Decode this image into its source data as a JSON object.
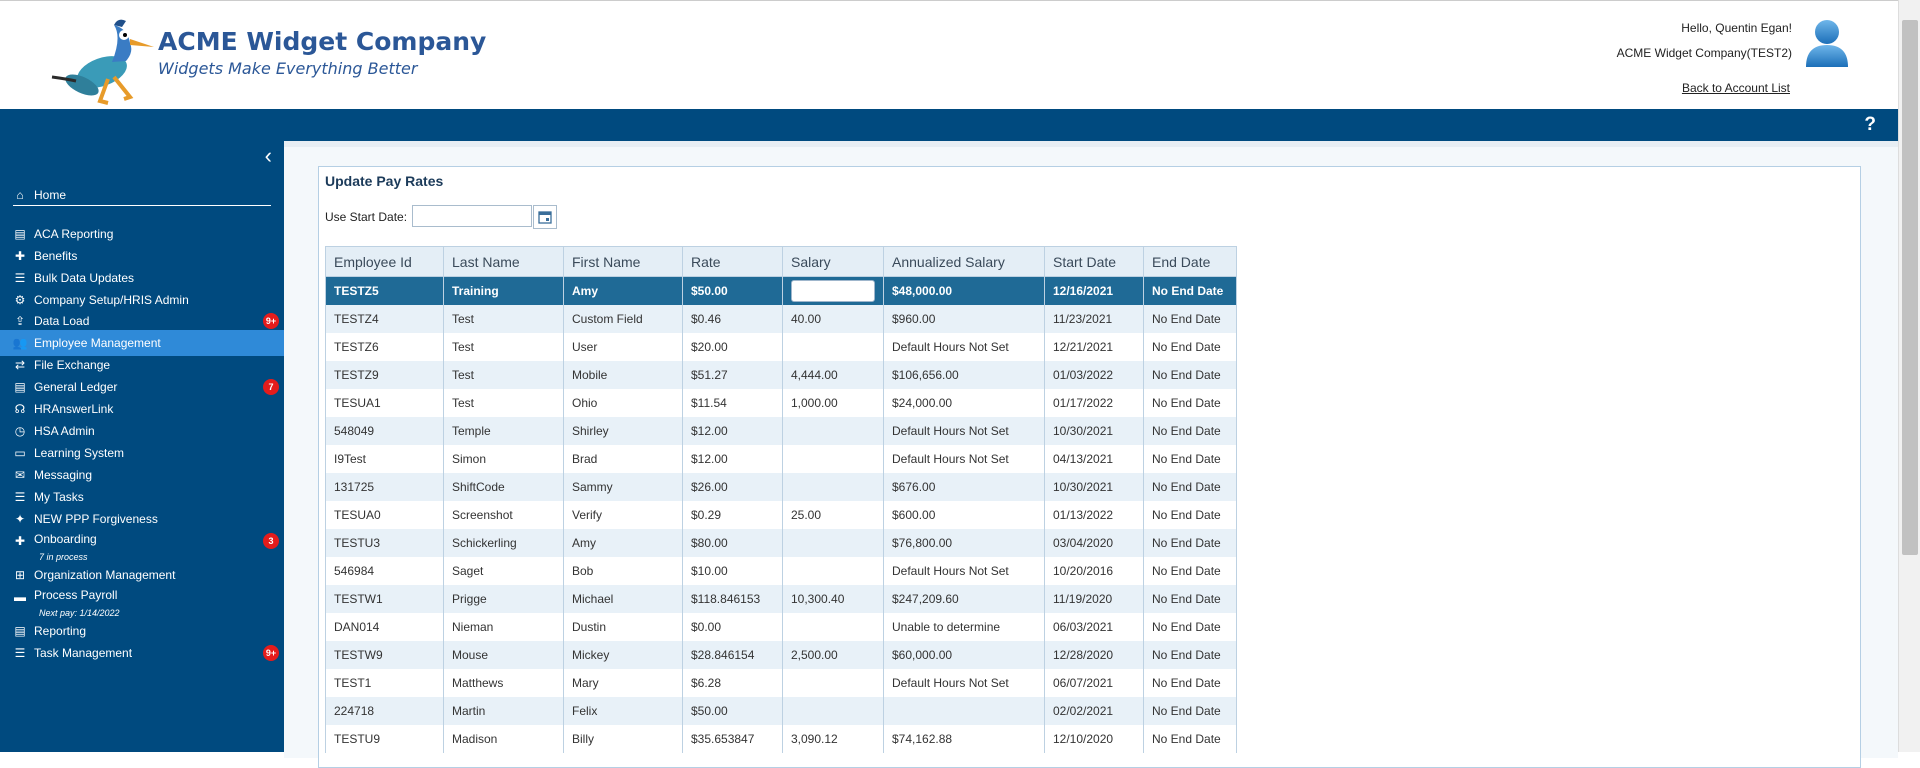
{
  "header": {
    "company_name": "ACME Widget Company",
    "tagline": "Widgets Make Everything Better",
    "greeting": "Hello, Quentin Egan!",
    "account_name": "ACME Widget Company(TEST2)",
    "back_link": "Back to Account List",
    "help_label": "?"
  },
  "colors": {
    "brand_blue": "#004a7f",
    "active_nav": "#2f8ad8",
    "selected_row": "#1f6a96",
    "badge_red": "#e41c1c"
  },
  "sidebar": {
    "collapse_icon": "chevron-left-icon",
    "items": [
      {
        "label": "Home",
        "icon": "home-icon"
      },
      {
        "label": "ACA Reporting",
        "icon": "document-icon"
      },
      {
        "label": "Benefits",
        "icon": "benefits-icon"
      },
      {
        "label": "Bulk Data Updates",
        "icon": "list-icon"
      },
      {
        "label": "Company Setup/HRIS Admin",
        "icon": "users-gear-icon"
      },
      {
        "label": "Data Load",
        "icon": "upload-icon",
        "badge": "9+"
      },
      {
        "label": "Employee Management",
        "icon": "users-icon",
        "active": true
      },
      {
        "label": "File Exchange",
        "icon": "exchange-icon"
      },
      {
        "label": "General Ledger",
        "icon": "ledger-icon",
        "badge": "7"
      },
      {
        "label": "HRAnswerLink",
        "icon": "headset-icon"
      },
      {
        "label": "HSA Admin",
        "icon": "clock-icon"
      },
      {
        "label": "Learning System",
        "icon": "laptop-icon"
      },
      {
        "label": "Messaging",
        "icon": "comments-icon"
      },
      {
        "label": "My Tasks",
        "icon": "tasks-icon"
      },
      {
        "label": "NEW PPP Forgiveness",
        "icon": "gift-icon"
      },
      {
        "label": "Onboarding",
        "icon": "user-plus-icon",
        "badge": "3",
        "sub": "7 in process"
      },
      {
        "label": "Organization Management",
        "icon": "org-chart-icon"
      },
      {
        "label": "Process Payroll",
        "icon": "money-icon",
        "sub": "Next pay: 1/14/2022"
      },
      {
        "label": "Reporting",
        "icon": "report-icon"
      },
      {
        "label": "Task Management",
        "icon": "tasks-icon",
        "badge": "9+"
      }
    ]
  },
  "main": {
    "title": "Update Pay Rates",
    "start_date_label": "Use Start Date:",
    "start_date_value": "",
    "columns": [
      "Employee Id",
      "Last Name",
      "First Name",
      "Rate",
      "Salary",
      "Annualized Salary",
      "Start Date",
      "End Date"
    ],
    "rows": [
      [
        "TESTZ5",
        "Training",
        "Amy",
        "$50.00",
        "",
        "$48,000.00",
        "12/16/2021",
        "No End Date"
      ],
      [
        "TESTZ4",
        "Test",
        "Custom Field",
        "$0.46",
        "40.00",
        "$960.00",
        "11/23/2021",
        "No End Date"
      ],
      [
        "TESTZ6",
        "Test",
        "User",
        "$20.00",
        "",
        "Default Hours Not Set",
        "12/21/2021",
        "No End Date"
      ],
      [
        "TESTZ9",
        "Test",
        "Mobile",
        "$51.27",
        "4,444.00",
        "$106,656.00",
        "01/03/2022",
        "No End Date"
      ],
      [
        "TESUA1",
        "Test",
        "Ohio",
        "$11.54",
        "1,000.00",
        "$24,000.00",
        "01/17/2022",
        "No End Date"
      ],
      [
        "548049",
        "Temple",
        "Shirley",
        "$12.00",
        "",
        "Default Hours Not Set",
        "10/30/2021",
        "No End Date"
      ],
      [
        "I9Test",
        "Simon",
        "Brad",
        "$12.00",
        "",
        "Default Hours Not Set",
        "04/13/2021",
        "No End Date"
      ],
      [
        "131725",
        "ShiftCode",
        "Sammy",
        "$26.00",
        "",
        "$676.00",
        "10/30/2021",
        "No End Date"
      ],
      [
        "TESUA0",
        "Screenshot",
        "Verify",
        "$0.29",
        "25.00",
        "$600.00",
        "01/13/2022",
        "No End Date"
      ],
      [
        "TESTU3",
        "Schickerling",
        "Amy",
        "$80.00",
        "",
        "$76,800.00",
        "03/04/2020",
        "No End Date"
      ],
      [
        "546984",
        "Saget",
        "Bob",
        "$10.00",
        "",
        "Default Hours Not Set",
        "10/20/2016",
        "No End Date"
      ],
      [
        "TESTW1",
        "Prigge",
        "Michael",
        "$118.846153",
        "10,300.40",
        "$247,209.60",
        "11/19/2020",
        "No End Date"
      ],
      [
        "DAN014",
        "Nieman",
        "Dustin",
        "$0.00",
        "",
        "Unable to determine",
        "06/03/2021",
        "No End Date"
      ],
      [
        "TESTW9",
        "Mouse",
        "Mickey",
        "$28.846154",
        "2,500.00",
        "$60,000.00",
        "12/28/2020",
        "No End Date"
      ],
      [
        "TEST1",
        "Matthews",
        "Mary",
        "$6.28",
        "",
        "Default Hours Not Set",
        "06/07/2021",
        "No End Date"
      ],
      [
        "224718",
        "Martin",
        "Felix",
        "$50.00",
        "",
        "",
        "02/02/2021",
        "No End Date"
      ],
      [
        "TESTU9",
        "Madison",
        "Billy",
        "$35.653847",
        "3,090.12",
        "$74,162.88",
        "12/10/2020",
        "No End Date"
      ]
    ]
  }
}
